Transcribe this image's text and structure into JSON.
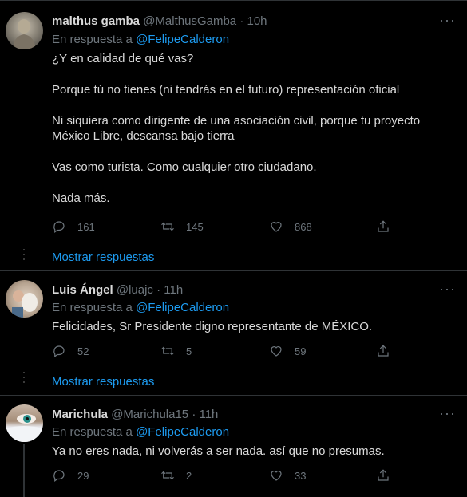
{
  "tweets": [
    {
      "name": "malthus gamba",
      "handle": "@MalthusGamba",
      "time": "· 10h",
      "reply_prefix": "En respuesta a",
      "reply_to": "@FelipeCalderon",
      "paragraphs": [
        "¿Y en calidad de qué vas?",
        "Porque tú no tienes (ni tendrás en el futuro) representación oficial",
        "Ni siquiera como dirigente de una asociación civil, porque tu proyecto México Libre, descansa bajo tierra",
        "Vas como turista. Como cualquier otro ciudadano.",
        "Nada más."
      ],
      "replies": "161",
      "retweets": "145",
      "likes": "868",
      "show_replies": "Mostrar respuestas"
    },
    {
      "name": "Luis Ángel",
      "handle": "@luajc",
      "time": "· 11h",
      "reply_prefix": "En respuesta a",
      "reply_to": "@FelipeCalderon",
      "paragraphs": [
        "Felicidades, Sr Presidente digno representante de MÉXICO."
      ],
      "replies": "52",
      "retweets": "5",
      "likes": "59",
      "show_replies": "Mostrar respuestas"
    },
    {
      "name": "Marichula",
      "handle": "@Marichula15",
      "time": "· 11h",
      "reply_prefix": "En respuesta a",
      "reply_to": "@FelipeCalderon",
      "paragraphs": [
        "Ya no eres nada, ni volverás a ser nada. así que no presumas."
      ],
      "replies": "29",
      "retweets": "2",
      "likes": "33"
    }
  ],
  "more_icon": "···",
  "colors": {
    "link": "#1d9bf0",
    "muted": "#6e767d",
    "text": "#d9d9d9",
    "background": "#000000"
  },
  "icons": [
    "reply-icon",
    "retweet-icon",
    "like-icon",
    "share-icon",
    "more-options-icon"
  ]
}
